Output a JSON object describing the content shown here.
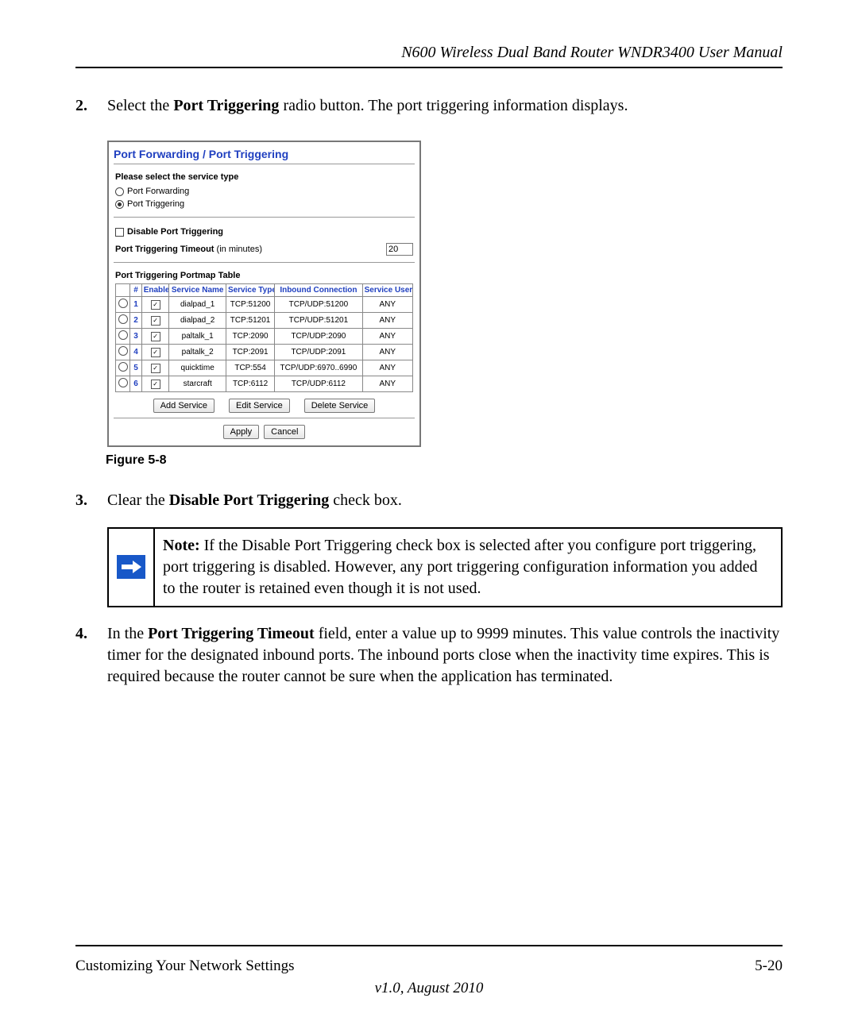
{
  "header": {
    "title": "N600 Wireless Dual Band Router WNDR3400 User Manual"
  },
  "steps": {
    "s2": {
      "num": "2.",
      "prefix": "Select the ",
      "bold": "Port Triggering",
      "suffix": " radio button. The port triggering information displays."
    },
    "s3": {
      "num": "3.",
      "prefix": "Clear the ",
      "bold": "Disable Port Triggering",
      "suffix": " check box."
    },
    "s4": {
      "num": "4.",
      "prefix": "In the ",
      "bold": "Port Triggering Timeout",
      "suffix": " field, enter a value up to 9999 minutes. This value controls the inactivity timer for the designated inbound ports. The inbound ports close when the inactivity time expires. This is required because the router cannot be sure when the application has terminated."
    }
  },
  "router": {
    "title": "Port Forwarding / Port Triggering",
    "select_label": "Please select the service type",
    "radio_forwarding": "Port Forwarding",
    "radio_triggering": "Port Triggering",
    "disable_label": "Disable Port Triggering",
    "timeout_label_prefix": "Port Triggering Timeout",
    "timeout_label_suffix": " (in minutes)",
    "timeout_value": "20",
    "table_title": "Port Triggering Portmap Table",
    "headers": {
      "num": "#",
      "enable": "Enable",
      "service_name": "Service Name",
      "service_type": "Service Type",
      "inbound": "Inbound Connection",
      "service_user": "Service User"
    },
    "rows": [
      {
        "n": "1",
        "name": "dialpad_1",
        "type": "TCP:51200",
        "inbound": "TCP/UDP:51200",
        "user": "ANY"
      },
      {
        "n": "2",
        "name": "dialpad_2",
        "type": "TCP:51201",
        "inbound": "TCP/UDP:51201",
        "user": "ANY"
      },
      {
        "n": "3",
        "name": "paltalk_1",
        "type": "TCP:2090",
        "inbound": "TCP/UDP:2090",
        "user": "ANY"
      },
      {
        "n": "4",
        "name": "paltalk_2",
        "type": "TCP:2091",
        "inbound": "TCP/UDP:2091",
        "user": "ANY"
      },
      {
        "n": "5",
        "name": "quicktime",
        "type": "TCP:554",
        "inbound": "TCP/UDP:6970..6990",
        "user": "ANY"
      },
      {
        "n": "6",
        "name": "starcraft",
        "type": "TCP:6112",
        "inbound": "TCP/UDP:6112",
        "user": "ANY"
      }
    ],
    "buttons": {
      "add": "Add Service",
      "edit": "Edit Service",
      "delete": "Delete Service",
      "apply": "Apply",
      "cancel": "Cancel"
    }
  },
  "figure_caption": "Figure 5-8",
  "note": {
    "bold": "Note:",
    "text": " If the Disable Port Triggering check box is selected after you configure port triggering, port triggering is disabled. However, any port triggering configuration information you added to the router is retained even though it is not used."
  },
  "footer": {
    "section": "Customizing Your Network Settings",
    "page": "5-20",
    "version": "v1.0, August 2010"
  }
}
